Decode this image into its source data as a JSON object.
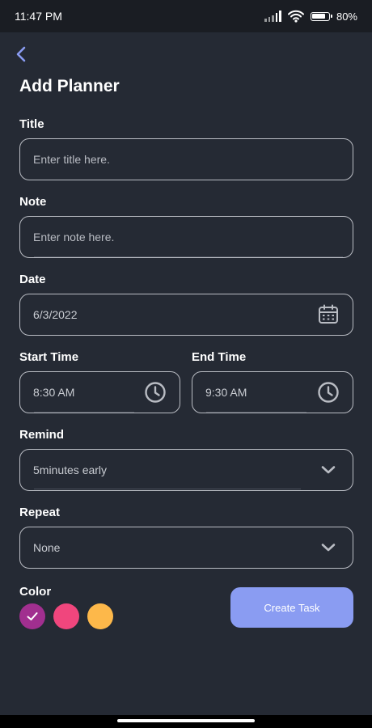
{
  "status": {
    "time": "11:47 PM",
    "battery": "80%",
    "battery_level": 0.8
  },
  "header": {
    "title": "Add Planner"
  },
  "form": {
    "title_label": "Title",
    "title_placeholder": "Enter title here.",
    "note_label": "Note",
    "note_placeholder": "Enter note here.",
    "date_label": "Date",
    "date_value": "6/3/2022",
    "start_label": "Start Time",
    "start_value": "8:30 AM",
    "end_label": "End Time",
    "end_value": "9:30 AM",
    "remind_label": "Remind",
    "remind_value": "5minutes early",
    "repeat_label": "Repeat",
    "repeat_value": "None",
    "color_label": "Color"
  },
  "colors": {
    "purple": "#a12f8f",
    "pink": "#f0467d",
    "orange": "#fdb84a",
    "accent": "#8a9cf2",
    "background": "#252a34"
  },
  "actions": {
    "create_label": "Create Task"
  }
}
